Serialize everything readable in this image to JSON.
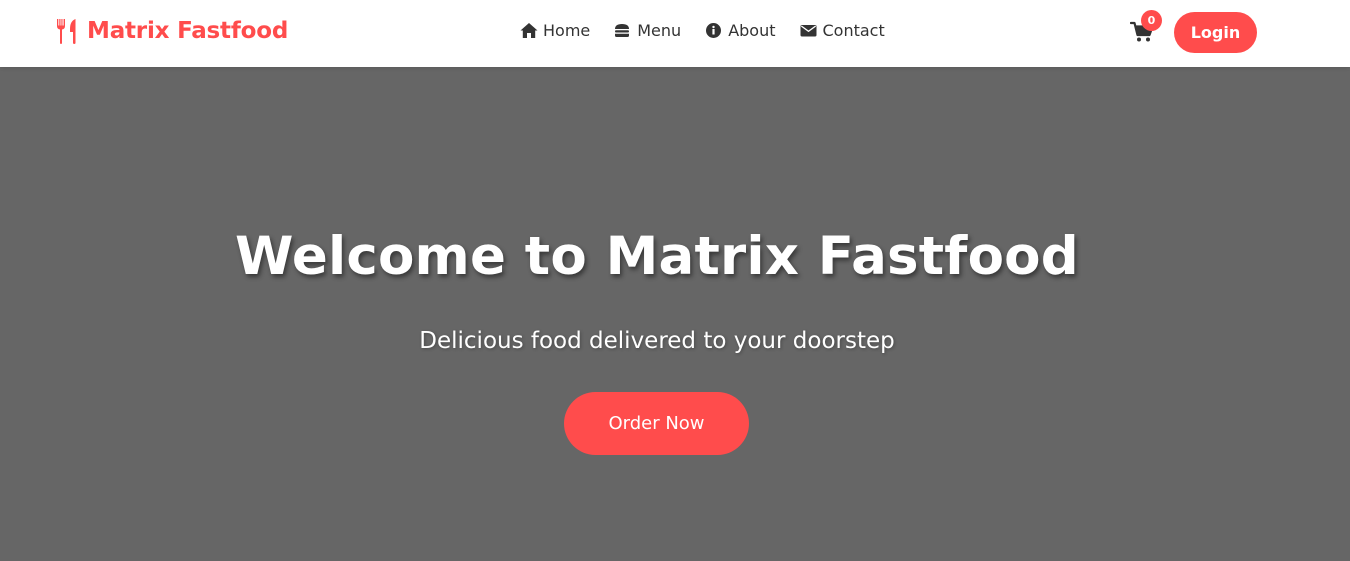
{
  "brand": {
    "name": "Matrix Fastfood",
    "icon": "utensils-icon",
    "color": "#ff4c4c"
  },
  "nav": {
    "items": [
      {
        "label": "Home",
        "icon": "home-icon"
      },
      {
        "label": "Menu",
        "icon": "burger-icon"
      },
      {
        "label": "About",
        "icon": "info-circle-icon"
      },
      {
        "label": "Contact",
        "icon": "envelope-icon"
      }
    ]
  },
  "cart": {
    "icon": "cart-icon",
    "count": "0"
  },
  "login": {
    "label": "Login"
  },
  "hero": {
    "title": "Welcome to Matrix Fastfood",
    "subtitle": "Delicious food delivered to your doorstep",
    "cta_label": "Order Now",
    "background": "#666666"
  },
  "colors": {
    "accent": "#ff4c4c",
    "nav_text": "#333333",
    "hero_text": "#ffffff"
  }
}
